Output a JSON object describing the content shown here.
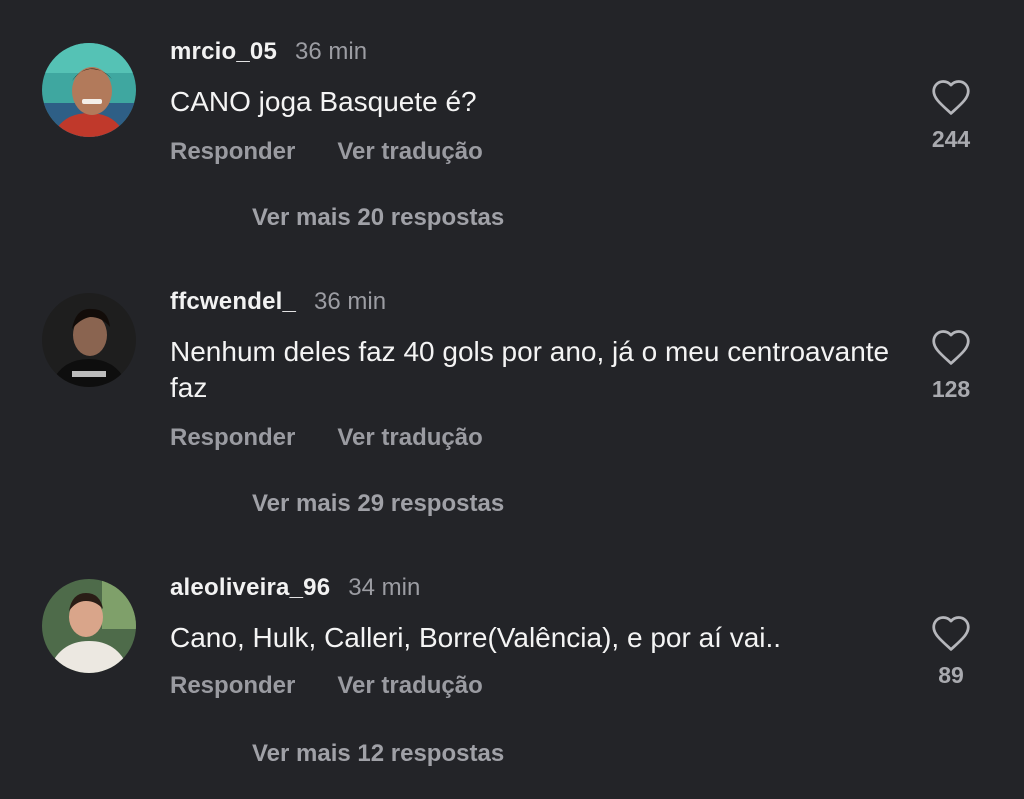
{
  "comments": [
    {
      "username": "mrcio_05",
      "time": "36 min",
      "text": "CANO joga Basquete é?",
      "reply_label": "Responder",
      "translate_label": "Ver tradução",
      "likes": "244",
      "more_replies": "Ver mais 20 respostas",
      "avatar_icon": "user-photo"
    },
    {
      "username": "ffcwendel_",
      "time": "36 min",
      "text": "Nenhum deles faz 40 gols por ano, já o meu centroavante faz",
      "reply_label": "Responder",
      "translate_label": "Ver tradução",
      "likes": "128",
      "more_replies": "Ver mais 29 respostas",
      "avatar_icon": "user-photo"
    },
    {
      "username": "aleoliveira_96",
      "time": "34 min",
      "text": "Cano, Hulk, Calleri, Borre(Valência), e por aí vai..",
      "reply_label": "Responder",
      "translate_label": "Ver tradução",
      "likes": "89",
      "more_replies": "Ver mais 12 respostas",
      "avatar_icon": "user-photo"
    }
  ],
  "icons": {
    "like": "heart-icon"
  },
  "colors": {
    "background": "#232428",
    "primary_text": "#f4f4f4",
    "secondary_text": "#9a9ba1"
  }
}
